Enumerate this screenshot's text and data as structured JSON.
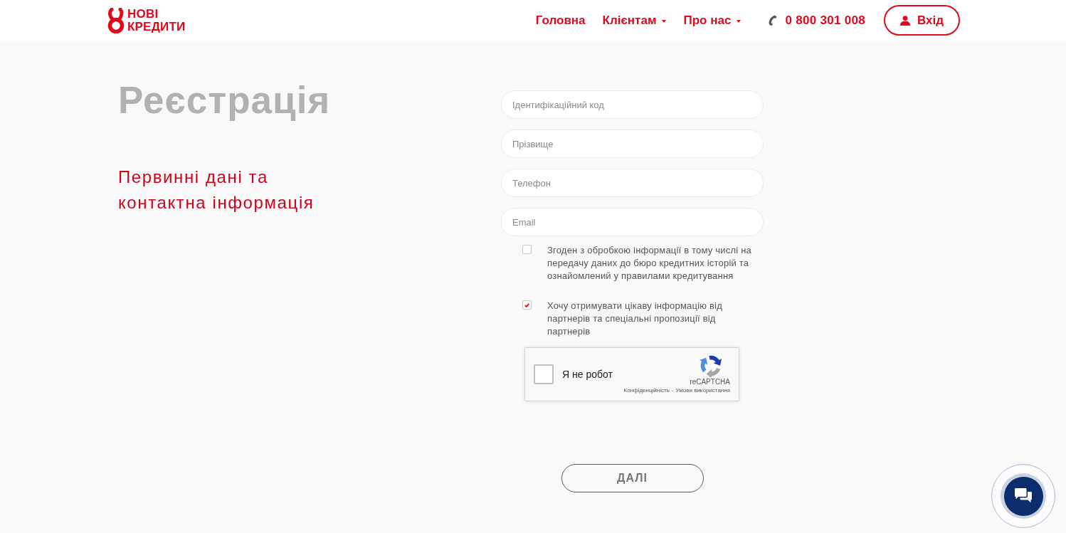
{
  "header": {
    "logo": {
      "line_1": "НОВІ",
      "line_2": "КРЕДИТИ"
    },
    "nav": [
      {
        "label": "Головна",
        "dropdown": false
      },
      {
        "label": "Клієнтам",
        "dropdown": true
      },
      {
        "label": "Про нас",
        "dropdown": true
      }
    ],
    "phone": "0 800 301 008",
    "login": "Вхід"
  },
  "page": {
    "title": "Реєстрація",
    "subtitle": "Первинні дані та контактна інформація"
  },
  "form": {
    "fields": [
      {
        "placeholder": "Ідентифікаційний код"
      },
      {
        "placeholder": "Прізвище"
      },
      {
        "placeholder": "Телефон"
      },
      {
        "placeholder": "Email"
      }
    ],
    "consents": [
      {
        "text": "Згоден з обробкою інформації в тому числі на передачу даних до бюро кредитних історій та ознайомлений у правилами кредитування",
        "checked": false
      },
      {
        "text": "Хочу отримувати цікаву інформацію від партнерів та спеціальні пропозиції від партнерів",
        "checked": true
      }
    ],
    "captcha": {
      "label": "Я не робот",
      "checked": false,
      "brand": "reCAPTCHA",
      "privacy": "Конфіденційність",
      "separator": "-",
      "terms": "Умови використання"
    },
    "submit": "ДАЛІ"
  }
}
